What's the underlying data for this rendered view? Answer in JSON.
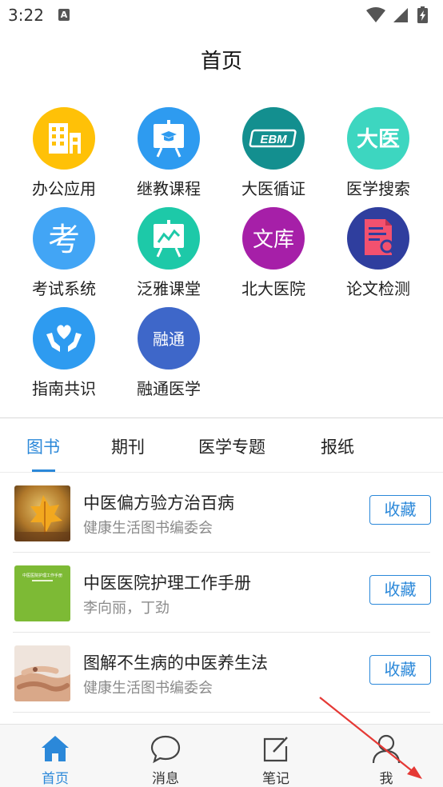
{
  "status_bar": {
    "time": "3:22",
    "notification_icon": "A"
  },
  "header": {
    "title": "首页"
  },
  "apps": [
    {
      "label": "办公应用",
      "icon": "office-buildings-icon",
      "color": "#FFC107"
    },
    {
      "label": "继教课程",
      "icon": "course-board-icon",
      "color": "#2E9BF0"
    },
    {
      "label": "大医循证",
      "icon": "ebm-icon",
      "color": "#138F8F",
      "icon_text": "EBM"
    },
    {
      "label": "医学搜索",
      "icon": "daiyi-icon",
      "color": "#3DD6C0",
      "icon_text": "大医"
    },
    {
      "label": "考试系统",
      "icon": "exam-icon",
      "color": "#42A5F5",
      "icon_text": "考"
    },
    {
      "label": "泛雅课堂",
      "icon": "classroom-chart-icon",
      "color": "#1DC9A8"
    },
    {
      "label": "北大医院",
      "icon": "library-icon",
      "color": "#A61FA8",
      "icon_text": "文库"
    },
    {
      "label": "论文检测",
      "icon": "paper-check-icon",
      "color": "#2F3E9E"
    },
    {
      "label": "指南共识",
      "icon": "heart-hands-icon",
      "color": "#2E9BF0"
    },
    {
      "label": "融通医学",
      "icon": "rongtong-icon",
      "color": "#3E67C9",
      "icon_text": "融通"
    }
  ],
  "tabs": [
    {
      "label": "图书",
      "active": true
    },
    {
      "label": "期刊",
      "active": false
    },
    {
      "label": "医学专题",
      "active": false
    },
    {
      "label": "报纸",
      "active": false
    }
  ],
  "books": [
    {
      "title": "中医偏方验方治百病",
      "author": "健康生活图书编委会",
      "button": "收藏"
    },
    {
      "title": "中医医院护理工作手册",
      "author": "李向丽，丁劲",
      "button": "收藏",
      "cover_text": "中医医院护理工作手册"
    },
    {
      "title": "图解不生病的中医养生法",
      "author": "健康生活图书编委会",
      "button": "收藏"
    }
  ],
  "bottom_nav": [
    {
      "label": "首页",
      "icon": "home-icon",
      "active": true
    },
    {
      "label": "消息",
      "icon": "message-icon",
      "active": false
    },
    {
      "label": "笔记",
      "icon": "note-icon",
      "active": false
    },
    {
      "label": "我",
      "icon": "person-icon",
      "active": false
    }
  ],
  "colors": {
    "accent": "#2B88D9",
    "annotation_arrow": "#E53935"
  }
}
